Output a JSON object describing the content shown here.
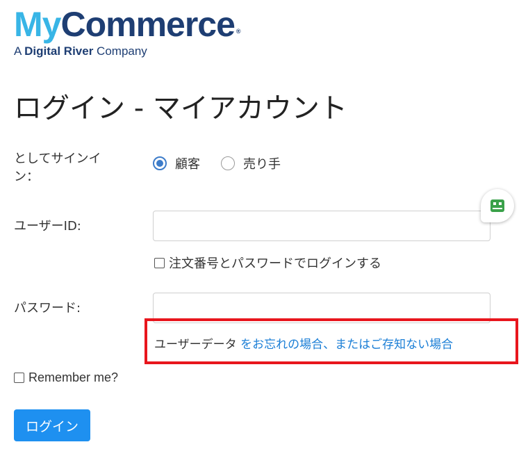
{
  "logo": {
    "my": "My",
    "commerce": "Commerce",
    "registered": "®",
    "sub_prefix": "A ",
    "sub_bold": "Digital River",
    "sub_suffix": " Company"
  },
  "page_title": "ログイン - マイアカウント",
  "signin": {
    "label": "としてサインイン：",
    "options": [
      {
        "label": "顧客",
        "checked": true
      },
      {
        "label": "売り手",
        "checked": false
      }
    ]
  },
  "userid": {
    "label": "ユーザーID:",
    "value": "",
    "placeholder": ""
  },
  "order_login_label": "注文番号とパスワードでログインする",
  "password": {
    "label": "パスワード:",
    "value": "",
    "placeholder": ""
  },
  "forgot": {
    "prefix": "ユーザーデータ",
    "link": " をお忘れの場合、またはご存知ない場合"
  },
  "remember_label": "Remember me?",
  "login_button": "ログイン",
  "colors": {
    "accent": "#1e90f0",
    "link": "#1a7ed6",
    "highlight": "#e8161d",
    "logo_light": "#38b5e6",
    "logo_dark": "#1e3e73",
    "chat_icon": "#3aa14a"
  },
  "icons": {
    "chat": "chat-bot-icon"
  }
}
